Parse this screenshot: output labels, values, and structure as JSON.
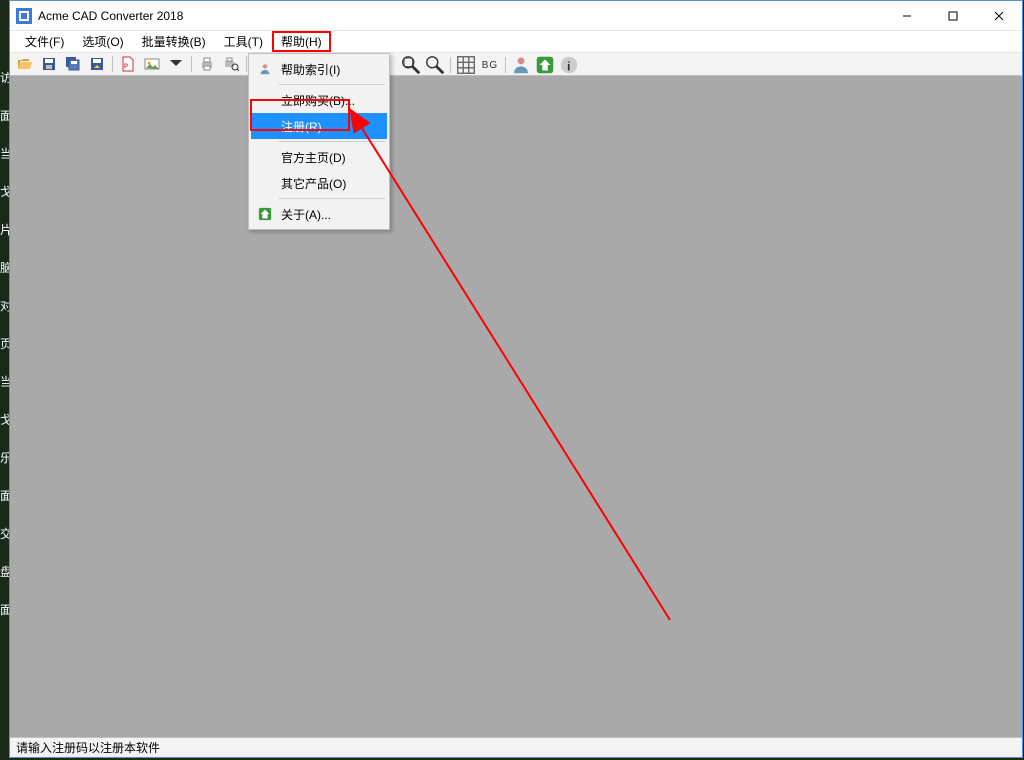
{
  "title": "Acme CAD Converter 2018",
  "menubar": {
    "file": "文件(F)",
    "options": "选项(O)",
    "batch": "批量转换(B)",
    "tools": "工具(T)",
    "help": "帮助(H)"
  },
  "toolbar_bg": "BG",
  "dropdown": {
    "help_index": "帮助索引(I)",
    "buy_now": "立即购买(B)...",
    "register": "注册(R)...",
    "homepage": "官方主页(D)",
    "other_products": "其它产品(O)",
    "about": "关于(A)..."
  },
  "statusbar": "请输入注册码以注册本软件",
  "desktop_fragments": [
    "访",
    "面",
    "当",
    "戈",
    "片",
    "脑",
    "对",
    "页",
    "当",
    "戈",
    "乐",
    "面",
    "交",
    "盘",
    "面"
  ]
}
